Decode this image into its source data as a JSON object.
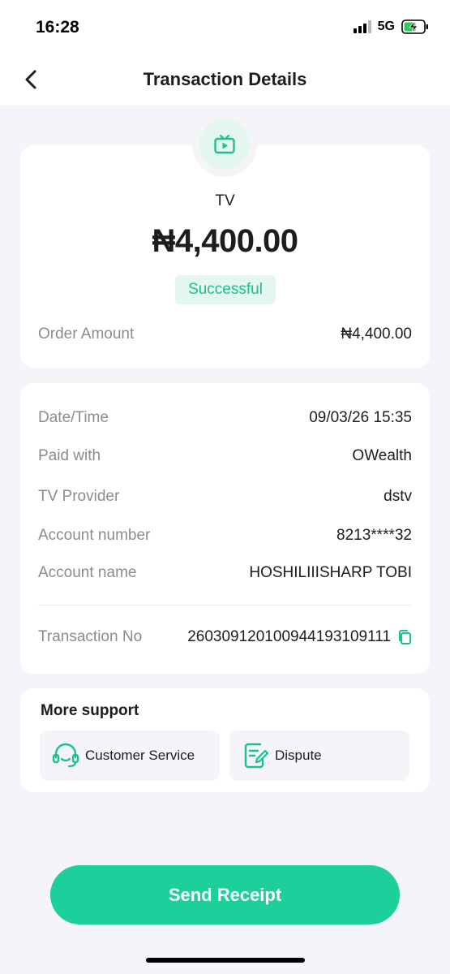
{
  "status_bar": {
    "time": "16:28",
    "network": "5G"
  },
  "header": {
    "title": "Transaction Details",
    "back_icon": "chevron-left-icon"
  },
  "summary": {
    "icon": "tv-icon",
    "category": "TV",
    "amount": "₦4,400.00",
    "status": "Successful",
    "order_amount_label": "Order Amount",
    "order_amount_value": "₦4,400.00"
  },
  "details": {
    "rows": [
      {
        "label": "Date/Time",
        "value": "09/03/26 15:35"
      },
      {
        "label": "Paid with",
        "value": "OWealth"
      },
      {
        "label": "TV Provider",
        "value": "dstv"
      },
      {
        "label": "Account number",
        "value": "8213****32"
      },
      {
        "label": "Account name",
        "value": "HOSHILIIISHARP TOBI"
      }
    ],
    "transaction_no_label": "Transaction No",
    "transaction_no_value": "260309120100944193109111",
    "copy_icon": "copy-icon"
  },
  "support": {
    "title": "More support",
    "customer_service_label": "Customer Service",
    "dispute_label": "Dispute"
  },
  "send_receipt_label": "Send Receipt",
  "colors": {
    "accent": "#1dcf9b",
    "status_green": "#1cc08f",
    "badge_bg": "#e3f7ef",
    "page_bg": "#f5f5f9",
    "label_gray": "#8b8b93"
  }
}
